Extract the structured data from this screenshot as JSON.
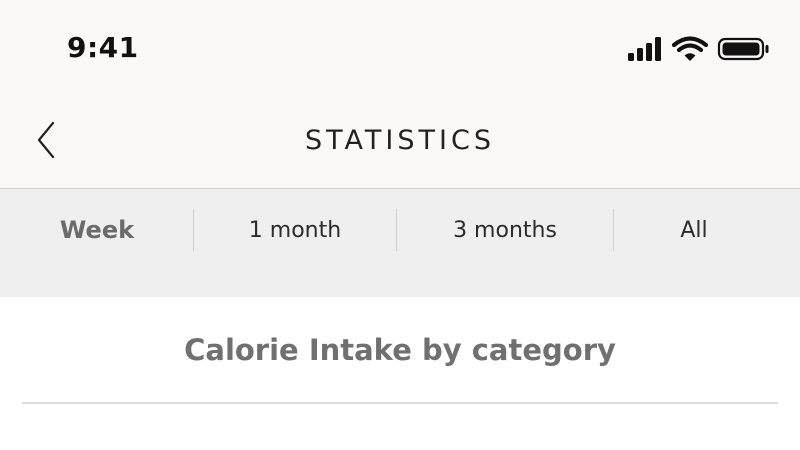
{
  "status_bar": {
    "time": "9:41",
    "icons": [
      "cellular-signal-icon",
      "wifi-icon",
      "battery-icon"
    ]
  },
  "nav": {
    "title": "STATISTICS",
    "back_icon": "chevron-left-icon"
  },
  "segments": {
    "items": [
      {
        "label": "Week",
        "active": true
      },
      {
        "label": "1 month",
        "active": false
      },
      {
        "label": "3 months",
        "active": false
      },
      {
        "label": "All",
        "active": false
      }
    ]
  },
  "content": {
    "title": "Calorie Intake by category"
  },
  "colors": {
    "header_background": "#fbf9f8",
    "segment_background": "#efefef",
    "active_segment_text": "#6b6b6b",
    "title_text": "#707070"
  }
}
